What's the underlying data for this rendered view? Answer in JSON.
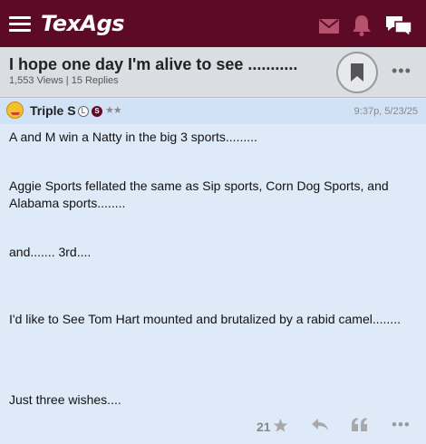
{
  "header": {
    "logo": "TexAgs",
    "icons": [
      "menu-icon",
      "mail-icon",
      "bell-icon",
      "chat-icon"
    ],
    "brand_color": "#5c0a26"
  },
  "thread": {
    "title": "I hope one day I'm alive to see ...........",
    "meta": "1,553 Views | 15 Replies"
  },
  "post": {
    "author": "Triple S",
    "badges": {
      "level": "L",
      "status": "S",
      "stars": "★★"
    },
    "timestamp": "9:37p, 5/23/25",
    "paragraphs": [
      "A and M win a Natty in the big 3 sports.........",
      "Aggie Sports fellated the same as Sip sports, Corn Dog Sports, and Alabama sports........",
      "and....... 3rd....",
      "I'd like to See Tom Hart mounted and brutalized by a rabid camel........",
      "Just three wishes...."
    ],
    "likes": "21",
    "action_icons": [
      "star-icon",
      "reply-icon",
      "quote-icon",
      "more-icon"
    ]
  },
  "more_label": "•••"
}
